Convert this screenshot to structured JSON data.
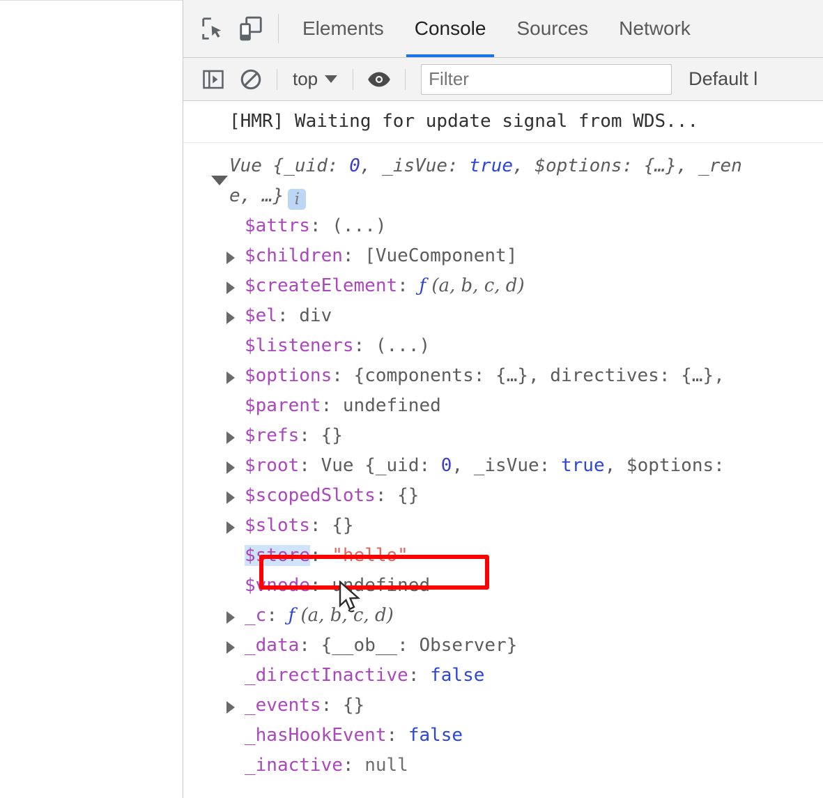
{
  "window": {
    "left_panel_label": "page-viewport"
  },
  "devtools": {
    "toolbar": {
      "inspect_icon": "inspect-element-icon",
      "device_icon": "device-toolbar-icon",
      "tabs": [
        {
          "label": "Elements",
          "active": false
        },
        {
          "label": "Console",
          "active": true
        },
        {
          "label": "Sources",
          "active": false
        },
        {
          "label": "Network",
          "active": false
        }
      ]
    },
    "filterbar": {
      "sidebar_icon": "console-sidebar-icon",
      "clear_icon": "clear-console-icon",
      "context": "top",
      "eye_icon": "live-expression-icon",
      "filter_placeholder": "Filter",
      "filter_value": "",
      "levels_label": "Default l"
    },
    "console": {
      "hmr_message": "[HMR] Waiting for update signal from WDS...",
      "object_header": {
        "ctor": "Vue ",
        "preview": "{_uid: 0, _isVue: true, $options: {…}, _ren",
        "preview_line2": "e, …}",
        "info_badge": "i"
      },
      "properties": [
        {
          "arrow": false,
          "key": "$attrs",
          "value": "(...)",
          "vtype": "plain"
        },
        {
          "arrow": true,
          "key": "$children",
          "value": "[VueComponent]",
          "vtype": "plain"
        },
        {
          "arrow": true,
          "key": "$createElement",
          "value": "ƒ (a, b, c, d)",
          "vtype": "fn"
        },
        {
          "arrow": true,
          "key": "$el",
          "value": "div",
          "vtype": "plain"
        },
        {
          "arrow": false,
          "key": "$listeners",
          "value": "(...)",
          "vtype": "plain"
        },
        {
          "arrow": true,
          "key": "$options",
          "value": "{components: {…}, directives: {…},",
          "vtype": "plain"
        },
        {
          "arrow": false,
          "key": "$parent",
          "value": "undefined",
          "vtype": "plain"
        },
        {
          "arrow": true,
          "key": "$refs",
          "value": "{}",
          "vtype": "plain"
        },
        {
          "arrow": true,
          "key": "$root",
          "value": "Vue {_uid: 0, _isVue: true, $options:",
          "vtype": "vue"
        },
        {
          "arrow": true,
          "key": "$scopedSlots",
          "value": "{}",
          "vtype": "plain"
        },
        {
          "arrow": true,
          "key": "$slots",
          "value": "{}",
          "vtype": "plain"
        },
        {
          "arrow": false,
          "key": "$store",
          "value": "\"hello\"",
          "vtype": "string",
          "selected": true,
          "highlighted": true
        },
        {
          "arrow": false,
          "key": "$vnode",
          "value": "undefined",
          "vtype": "plain"
        },
        {
          "arrow": true,
          "key": "_c",
          "value": "ƒ (a, b, c, d)",
          "vtype": "fn"
        },
        {
          "arrow": true,
          "key": "_data",
          "value": "{__ob__: Observer}",
          "vtype": "plain"
        },
        {
          "arrow": false,
          "key": "_directInactive",
          "value": "false",
          "vtype": "bool"
        },
        {
          "arrow": true,
          "key": "_events",
          "value": "{}",
          "vtype": "plain"
        },
        {
          "arrow": false,
          "key": "_hasHookEvent",
          "value": "false",
          "vtype": "bool"
        },
        {
          "arrow": false,
          "key": "_inactive",
          "value": "null",
          "vtype": "null"
        }
      ]
    }
  },
  "annotation": {
    "shape": "rectangle",
    "color": "#ff0000",
    "target_key": "$store",
    "target_value": "\"hello\""
  },
  "colors": {
    "accent_tab_underline": "#1a73e8",
    "annotation_red": "#ff0000",
    "key_purple": "#ab47bc",
    "string_red": "#e2665a",
    "bool_blue": "#2b46d8",
    "selection_blue": "#cfe3fb",
    "toolbar_bg": "#f3f3f3"
  }
}
